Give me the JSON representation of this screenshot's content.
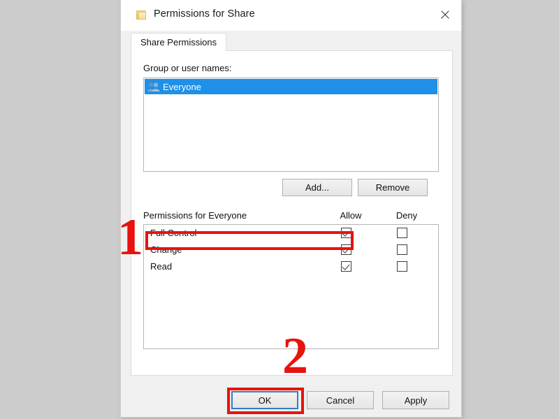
{
  "window": {
    "title": "Permissions for Share",
    "folder_icon": "folder-icon",
    "close_icon": "close-icon"
  },
  "tabs": [
    {
      "label": "Share Permissions",
      "active": true
    }
  ],
  "group_section": {
    "label": "Group or user names:",
    "items": [
      {
        "name": "Everyone",
        "icon": "users-icon",
        "selected": true
      }
    ],
    "add_label": "Add...",
    "remove_label": "Remove"
  },
  "permissions_section": {
    "label": "Permissions for Everyone",
    "columns": [
      "Allow",
      "Deny"
    ],
    "rows": [
      {
        "name": "Full Control",
        "allow": true,
        "deny": false
      },
      {
        "name": "Change",
        "allow": true,
        "deny": false
      },
      {
        "name": "Read",
        "allow": true,
        "deny": false
      }
    ]
  },
  "footer": {
    "ok_label": "OK",
    "cancel_label": "Cancel",
    "apply_label": "Apply"
  },
  "annotations": {
    "step_one": "1",
    "step_two": "2",
    "color": "#e8120e"
  },
  "colors": {
    "page_background": "#cccccc",
    "dialog_background": "#f0f0f0",
    "selection_blue": "#1e90e8",
    "focus_blue": "#3a7cbd"
  }
}
